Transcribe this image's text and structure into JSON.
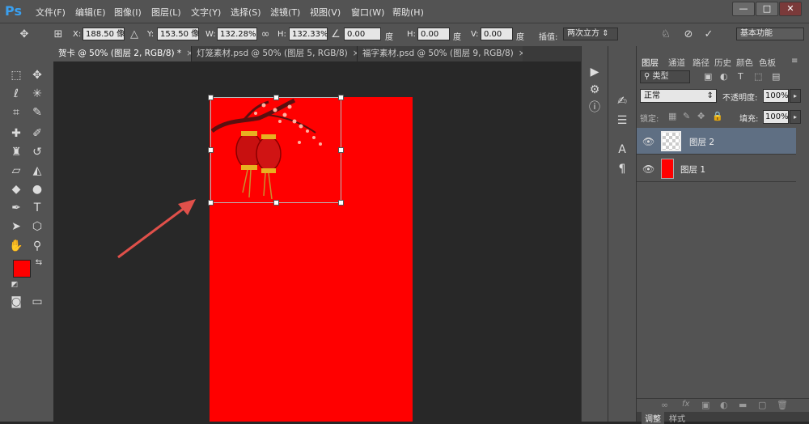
{
  "app": {
    "logo": "Ps"
  },
  "menu": [
    "文件(F)",
    "编辑(E)",
    "图像(I)",
    "图层(L)",
    "文字(Y)",
    "选择(S)",
    "滤镜(T)",
    "视图(V)",
    "窗口(W)",
    "帮助(H)"
  ],
  "window_controls": {
    "minimize": "—",
    "restore": "□",
    "close": "✕"
  },
  "options": {
    "x_label": "X:",
    "x_value": "188.50 像",
    "y_label": "Y:",
    "y_value": "153.50 像",
    "w_label": "W:",
    "w_value": "132.28%",
    "h_label": "H:",
    "h_value": "132.33%",
    "angle_value": "0.00",
    "angle_unit": "度",
    "hskew_label": "H:",
    "hskew_value": "0.00",
    "hskew_unit": "度",
    "vskew_label": "V:",
    "vskew_value": "0.00",
    "vskew_unit": "度",
    "interp_label": "插值:",
    "interp_value": "两次立方",
    "workspace": "基本功能"
  },
  "tabs": [
    {
      "label": "贺卡 @ 50% (图层 2, RGB/8) *",
      "close": "×"
    },
    {
      "label": "灯笼素材.psd @ 50% (图层 5, RGB/8)",
      "close": "×"
    },
    {
      "label": "福字素材.psd @ 50% (图层 9, RGB/8)",
      "close": "×"
    }
  ],
  "colors": {
    "foreground": "#ff0000",
    "background": "#ffffff",
    "document": "#ff0000"
  },
  "layers_panel": {
    "tabs": [
      "图层",
      "通道",
      "路径",
      "历史",
      "颜色",
      "色板"
    ],
    "filter_label": "类型",
    "blend_mode": "正常",
    "opacity_label": "不透明度:",
    "opacity_value": "100%",
    "lock_label": "锁定:",
    "fill_label": "填充:",
    "fill_value": "100%",
    "layers": [
      {
        "name": "图层 2",
        "selected": true
      },
      {
        "name": "图层 1",
        "selected": false
      }
    ],
    "bottom_tabs": [
      "调整",
      "样式"
    ]
  }
}
